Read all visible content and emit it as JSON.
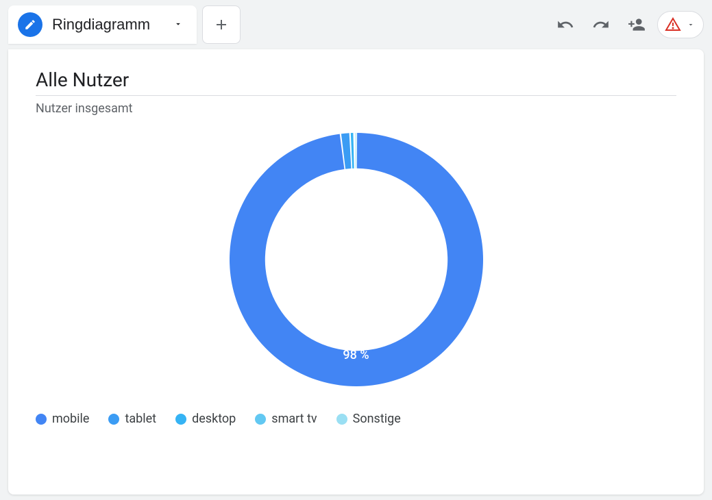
{
  "toolbar": {
    "tab_label": "Ringdiagramm"
  },
  "card": {
    "title": "Alle Nutzer",
    "subtitle": "Nutzer insgesamt"
  },
  "chart_data": {
    "type": "pie",
    "title": "Nutzer insgesamt",
    "series": [
      {
        "name": "mobile",
        "value": 98,
        "color": "#4285f4"
      },
      {
        "name": "tablet",
        "value": 1.2,
        "color": "#3b9cf4"
      },
      {
        "name": "desktop",
        "value": 0.5,
        "color": "#35b3f4"
      },
      {
        "name": "smart tv",
        "value": 0.2,
        "color": "#62c8f2"
      },
      {
        "name": "Sonstige",
        "value": 0.1,
        "color": "#9adff3"
      }
    ],
    "inner_radius_ratio": 0.72,
    "primary_label": "98 %"
  },
  "legend": [
    {
      "label": "mobile",
      "color": "#4285f4"
    },
    {
      "label": "tablet",
      "color": "#3b9cf4"
    },
    {
      "label": "desktop",
      "color": "#35b3f4"
    },
    {
      "label": "smart tv",
      "color": "#62c8f2"
    },
    {
      "label": "Sonstige",
      "color": "#9adff3"
    }
  ]
}
